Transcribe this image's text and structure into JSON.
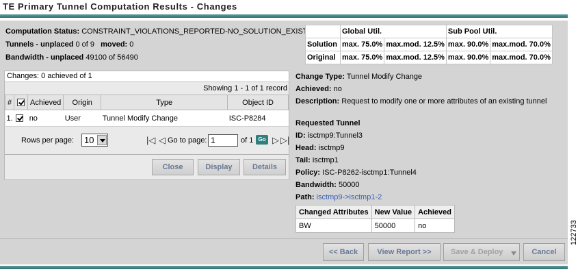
{
  "page_title": "TE Primary Tunnel Computation Results - Changes",
  "status": {
    "computation_label": "Computation Status:",
    "computation_value": "CONSTRAINT_VIOLATIONS_REPORTED-NO_SOLUTION_EXISTS",
    "tunnels_label": "Tunnels - unplaced",
    "tunnels_value": "0 of 9",
    "moved_label": "moved:",
    "moved_value": "0",
    "bandwidth_label": "Bandwidth - unplaced",
    "bandwidth_value": "49100 of 56490"
  },
  "util_table": {
    "global_header": "Global Util.",
    "subpool_header": "Sub Pool Util.",
    "rows": [
      {
        "label": "Solution",
        "global_max": "max. 75.0%",
        "global_maxmod": "max.mod. 12.5%",
        "sub_max": "max. 90.0%",
        "sub_maxmod": "max.mod. 70.0%"
      },
      {
        "label": "Original",
        "global_max": "max. 75.0%",
        "global_maxmod": "max.mod. 12.5%",
        "sub_max": "max. 90.0%",
        "sub_maxmod": "max.mod. 70.0%"
      }
    ]
  },
  "changes": {
    "header": "Changes: 0 achieved of 1",
    "showing": "Showing 1 - 1 of 1 record",
    "columns": {
      "num": "#",
      "achieved": "Achieved",
      "origin": "Origin",
      "type": "Type",
      "object_id": "Object ID"
    },
    "rows": [
      {
        "num": "1.",
        "achieved": "no",
        "origin": "User",
        "type": "Tunnel Modify Change",
        "object_id": "ISC-P8284"
      }
    ],
    "rows_per_page_label": "Rows per page:",
    "rows_per_page_value": "10",
    "goto_label": "Go to page:",
    "goto_value": "1",
    "of_label": "of 1",
    "go_label": "Go",
    "buttons": {
      "close": "Close",
      "display": "Display",
      "details": "Details"
    }
  },
  "detail": {
    "change_type_label": "Change Type:",
    "change_type_value": "Tunnel Modify Change",
    "achieved_label": "Achieved:",
    "achieved_value": "no",
    "description_label": "Description:",
    "description_value": "Request to modify one or more attributes of an existing tunnel",
    "requested_heading": "Requested Tunnel",
    "id_label": "ID:",
    "id_value": "isctmp9:Tunnel3",
    "head_label": "Head:",
    "head_value": "isctmp9",
    "tail_label": "Tail:",
    "tail_value": "isctmp1",
    "policy_label": "Policy:",
    "policy_value": "ISC-P8262-isctmp1:Tunnel4",
    "bandwidth_label": "Bandwidth:",
    "bandwidth_value": "50000",
    "path_label": "Path:",
    "path_value": "isctmp9->isctmp1-2"
  },
  "attr_table": {
    "headers": [
      "Changed Attributes",
      "New Value",
      "Achieved"
    ],
    "rows": [
      [
        "BW",
        "50000",
        "no"
      ]
    ]
  },
  "footer": {
    "back": "<< Back",
    "view_report": "View Report >>",
    "save_deploy": "Save & Deploy",
    "cancel": "Cancel"
  },
  "figure_id": "122733",
  "colors": {
    "accent": "#2f7f7f",
    "panel": "#d4d4d4",
    "button_text": "#6a7896",
    "link": "#3a5fb5"
  }
}
